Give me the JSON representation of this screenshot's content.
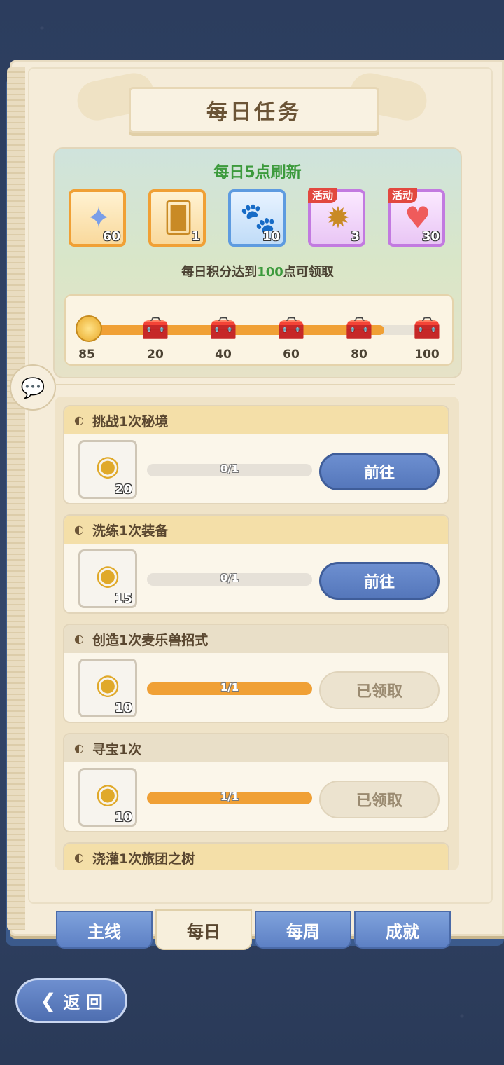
{
  "title": "每日任务",
  "refresh_note": "每日5点刷新",
  "rewards": [
    {
      "icon": "crystal-star-icon",
      "glyph": "✦",
      "count": "60",
      "tier": "gold"
    },
    {
      "icon": "card-icon",
      "glyph": "🂠",
      "count": "1",
      "tier": "gold"
    },
    {
      "icon": "paw-bag-icon",
      "glyph": "🐾",
      "count": "10",
      "tier": "blue"
    },
    {
      "icon": "badge-icon",
      "glyph": "✹",
      "count": "3",
      "tier": "purple",
      "badge": "活动"
    },
    {
      "icon": "heart-icon",
      "glyph": "♥",
      "count": "30",
      "tier": "purple",
      "badge": "活动"
    }
  ],
  "points_note": {
    "prefix": "每日积分达到",
    "highlight": "100",
    "suffix": "点可领取"
  },
  "points": {
    "current": "85",
    "current_value": 85,
    "max": 100,
    "milestones": [
      "20",
      "40",
      "60",
      "80",
      "100"
    ]
  },
  "tasks": [
    {
      "name": "挑战1次秘境",
      "reward_count": "20",
      "progress": "0/1",
      "fraction": 0,
      "button": "前往",
      "done": false
    },
    {
      "name": "洗练1次装备",
      "reward_count": "15",
      "progress": "0/1",
      "fraction": 0,
      "button": "前往",
      "done": false
    },
    {
      "name": "创造1次麦乐兽招式",
      "reward_count": "10",
      "progress": "1/1",
      "fraction": 1,
      "button": "已领取",
      "done": true
    },
    {
      "name": "寻宝1次",
      "reward_count": "10",
      "progress": "1/1",
      "fraction": 1,
      "button": "已领取",
      "done": true
    },
    {
      "name": "浇灌1次旅团之树",
      "reward_count": "",
      "progress": "",
      "fraction": 0,
      "button": "",
      "done": false
    }
  ],
  "tabs": [
    "主线",
    "每日",
    "每周",
    "成就"
  ],
  "active_tab": 1,
  "back_label": "返 回",
  "colors": {
    "accent_orange": "#f0a035",
    "go_blue": "#5577bb",
    "green": "#3c9a3c"
  }
}
